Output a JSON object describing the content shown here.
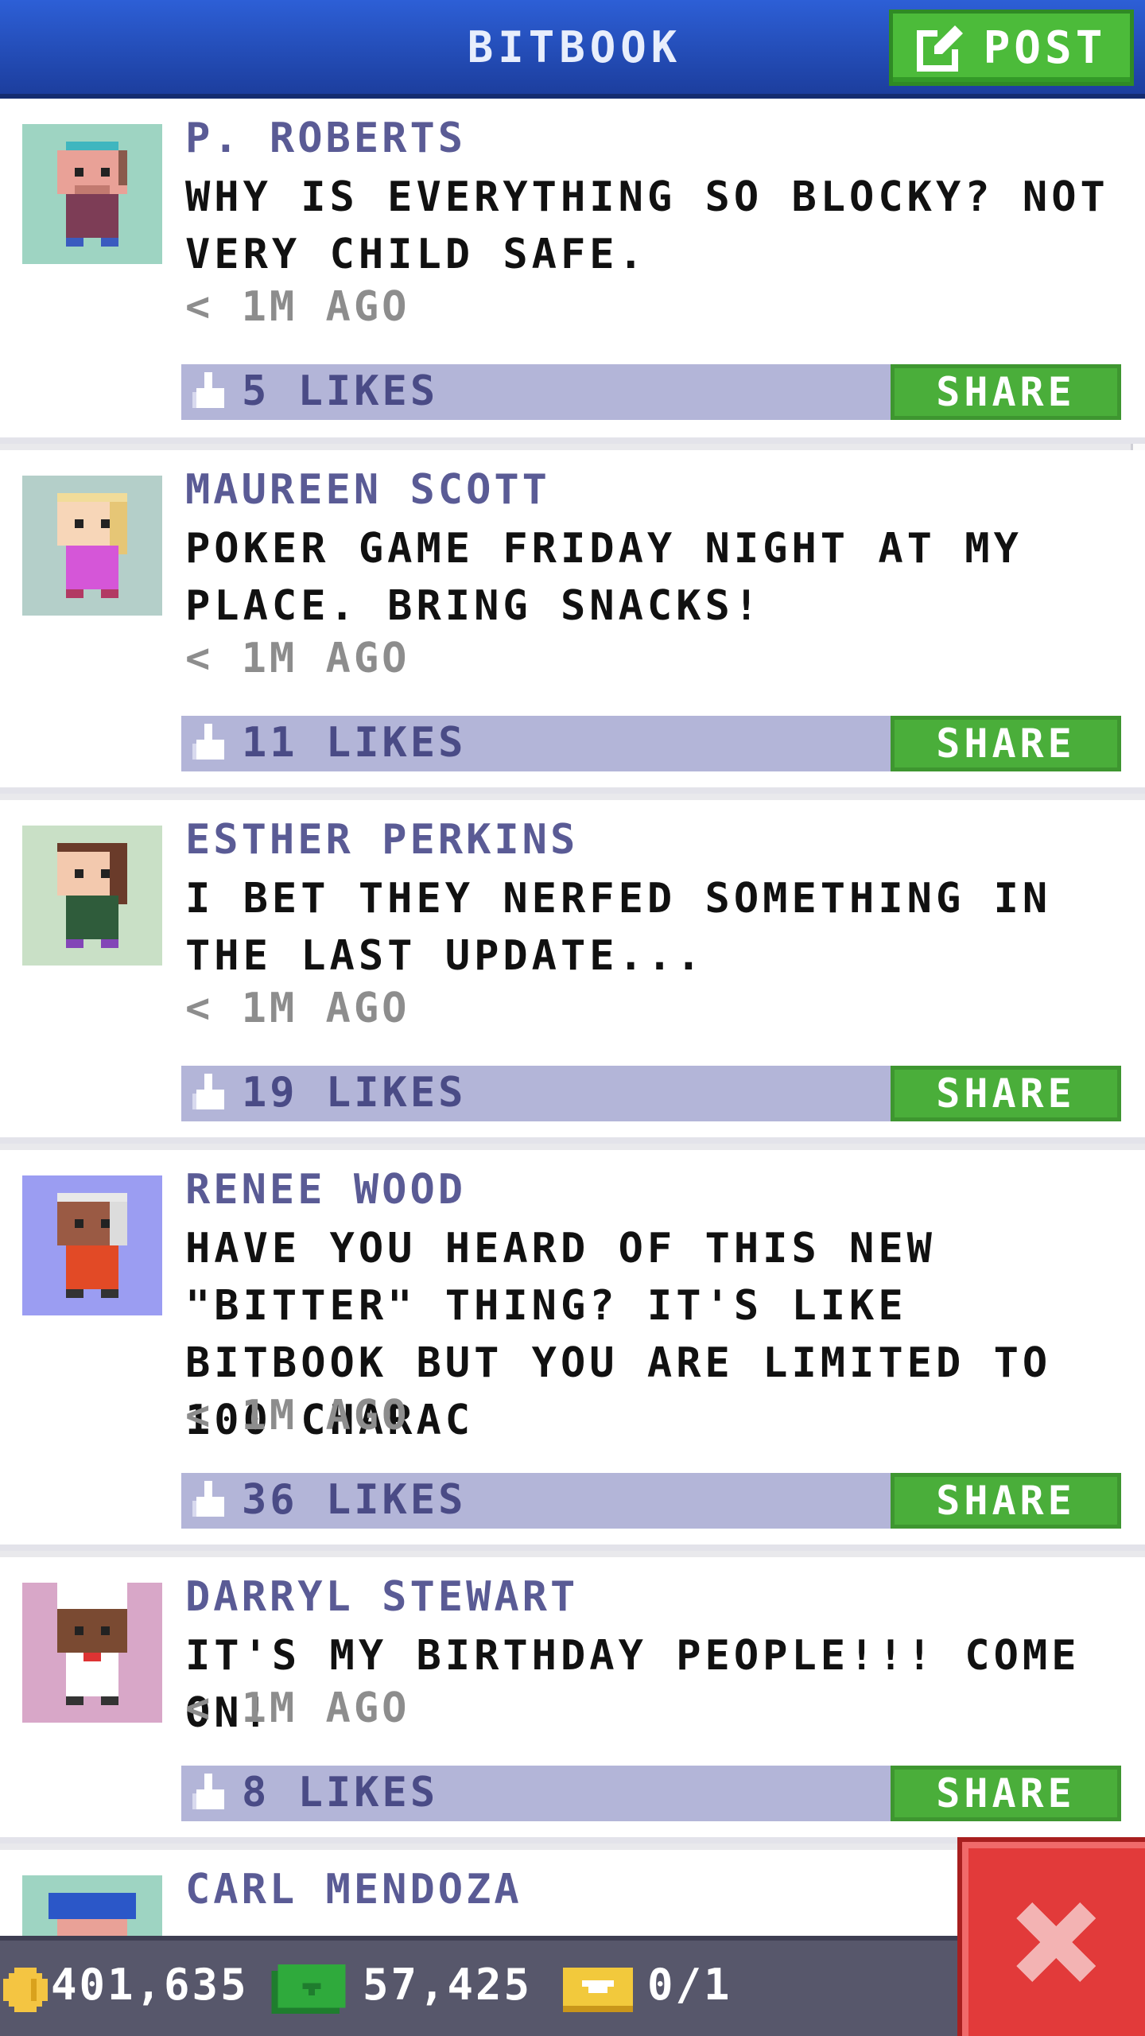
{
  "header": {
    "title": "BITBOOK",
    "post_label": "POST"
  },
  "posts": [
    {
      "author": "P. ROBERTS",
      "message": "WHY IS EVERYTHING SO BLOCKY? NOT VERY CHILD SAFE.",
      "time": "< 1M AGO",
      "likes": "5 LIKES",
      "share_label": "SHARE",
      "avatar_bg": "#9ed4c2"
    },
    {
      "author": "MAUREEN SCOTT",
      "message": "POKER GAME FRIDAY NIGHT AT MY PLACE. BRING SNACKS!",
      "time": "< 1M AGO",
      "likes": "11 LIKES",
      "share_label": "SHARE",
      "avatar_bg": "#b4cfc9"
    },
    {
      "author": "ESTHER PERKINS",
      "message": "I BET THEY NERFED SOMETHING IN THE LAST UPDATE...",
      "time": "< 1M AGO",
      "likes": "19 LIKES",
      "share_label": "SHARE",
      "avatar_bg": "#c9e0c6"
    },
    {
      "author": "RENEE WOOD",
      "message": "HAVE YOU HEARD OF THIS NEW \"BITTER\" THING? IT'S LIKE BITBOOK BUT YOU ARE LIMITED TO 100 CHARAC",
      "time": "< 1M AGO",
      "likes": "36 LIKES",
      "share_label": "SHARE",
      "avatar_bg": "#9b9df2"
    },
    {
      "author": "DARRYL STEWART",
      "message": "IT'S MY BIRTHDAY PEOPLE!!! COME ON!",
      "time": "< 1M AGO",
      "likes": "8 LIKES",
      "share_label": "SHARE",
      "avatar_bg": "#d8a7c8"
    },
    {
      "author": "CARL MENDOZA",
      "avatar_bg": "#9ed4c2"
    }
  ],
  "status": {
    "coins": "401,635",
    "bux": "57,425",
    "tickets": "0/1"
  },
  "colors": {
    "header": "#2d5fd6",
    "accent_green": "#4cbb3a",
    "likes_bar": "#b3b5d8",
    "close_red": "#e23a3a"
  },
  "icons": {
    "post": "edit-icon",
    "like": "thumbs-up-icon",
    "coin": "coin-icon",
    "bux": "bux-icon",
    "ticket": "ticket-icon",
    "close": "close-icon"
  }
}
